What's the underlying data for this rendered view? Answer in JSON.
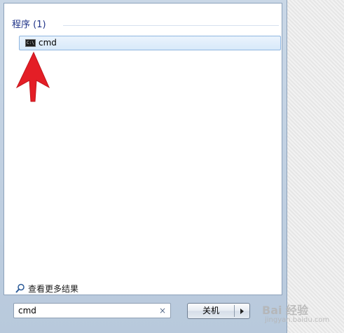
{
  "results_panel": {
    "group_header": "程序 (1)",
    "items": [
      {
        "label": "cmd",
        "icon": "cmd-console-icon",
        "icon_text": "C:\\"
      }
    ]
  },
  "see_more": {
    "label": "查看更多结果",
    "icon": "search-icon"
  },
  "search": {
    "value": "cmd",
    "clear_icon": "clear-x-icon",
    "clear_glyph": "×"
  },
  "shutdown": {
    "label": "关机",
    "arrow_icon": "chevron-right-icon"
  },
  "annotation": {
    "icon": "red-arrow-pointer",
    "color": "#e41e26"
  },
  "watermark": {
    "text": "Bai 经验",
    "sub": "jingyan.baidu.com"
  },
  "colors": {
    "accent": "#1e3287",
    "selection_fill": "#d8e9fa",
    "selection_border": "#8fb6e0"
  }
}
